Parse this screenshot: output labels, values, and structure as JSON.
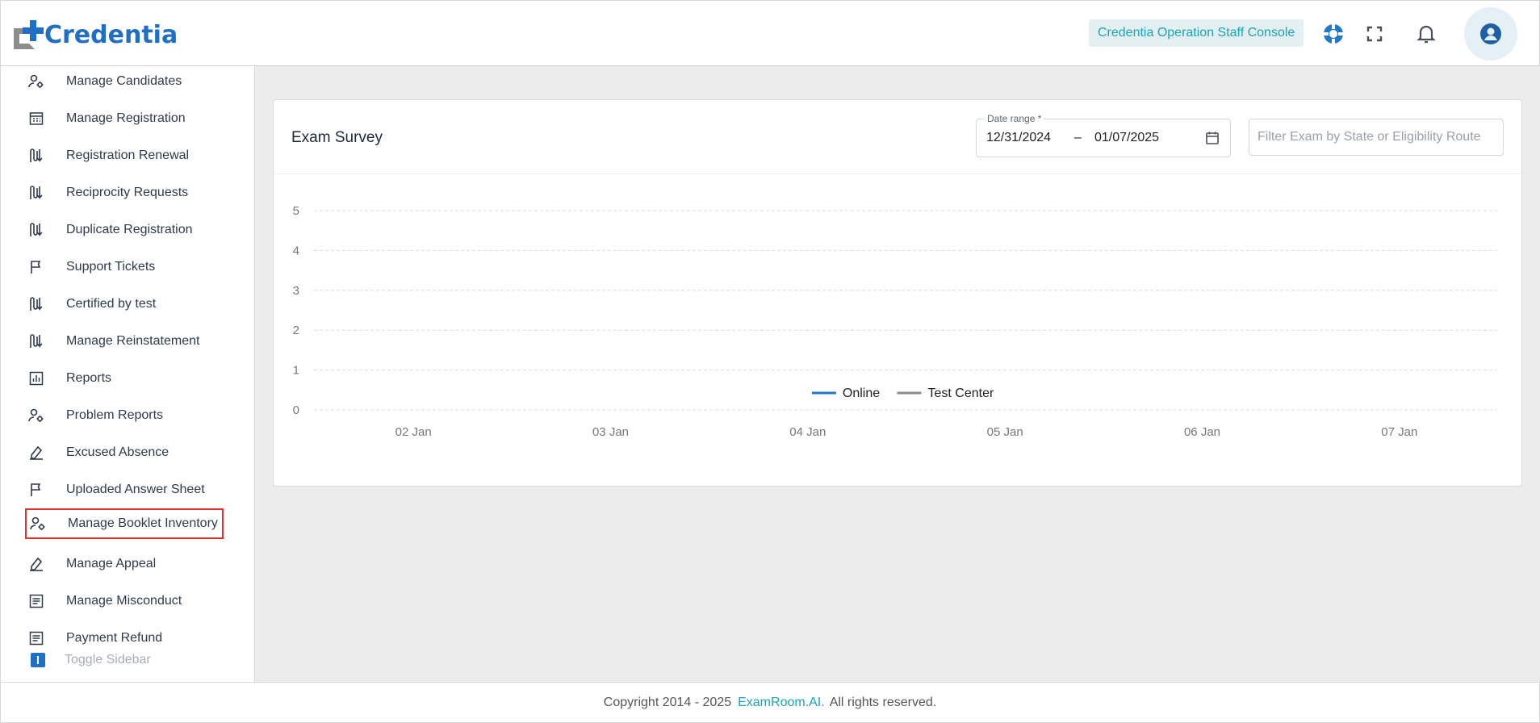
{
  "header": {
    "logo_text": "Credentia",
    "console_label": "Credentia Operation Staff Console",
    "icons": [
      "support-icon",
      "fullscreen-icon",
      "bell-icon",
      "account-icon"
    ]
  },
  "sidebar": {
    "items": [
      {
        "label": "Manage Candidates",
        "icon": "user-gear-icon"
      },
      {
        "label": "Manage Registration",
        "icon": "calendar-grid-icon"
      },
      {
        "label": "Registration Renewal",
        "icon": "swap-arrows-icon"
      },
      {
        "label": "Reciprocity Requests",
        "icon": "swap-arrows-icon"
      },
      {
        "label": "Duplicate Registration",
        "icon": "swap-arrows-icon"
      },
      {
        "label": "Support Tickets",
        "icon": "flag-icon"
      },
      {
        "label": "Certified by test",
        "icon": "swap-arrows-icon"
      },
      {
        "label": "Manage Reinstatement",
        "icon": "swap-arrows-icon"
      },
      {
        "label": "Reports",
        "icon": "bar-chart-icon"
      },
      {
        "label": "Problem Reports",
        "icon": "user-gear-icon"
      },
      {
        "label": "Excused Absence",
        "icon": "stamp-icon"
      },
      {
        "label": "Uploaded Answer Sheet",
        "icon": "flag-icon"
      },
      {
        "label": "Manage Booklet Inventory",
        "icon": "user-gear-icon"
      },
      {
        "label": "Manage Appeal",
        "icon": "stamp-icon"
      },
      {
        "label": "Manage Misconduct",
        "icon": "document-lines-icon"
      },
      {
        "label": "Payment Refund",
        "icon": "document-lines-icon"
      }
    ],
    "toggle_label": "Toggle Sidebar"
  },
  "card": {
    "title": "Exam Survey",
    "date_range_label": "Date range *",
    "date_start": "12/31/2024",
    "date_sep": "–",
    "date_end": "01/07/2025",
    "filter_placeholder": "Filter Exam by State or Eligibility Route"
  },
  "chart_data": {
    "type": "line",
    "x": [
      "02 Jan",
      "03 Jan",
      "04 Jan",
      "05 Jan",
      "06 Jan",
      "07 Jan"
    ],
    "yticks": [
      0,
      1,
      2,
      3,
      4,
      5
    ],
    "ylim": [
      0,
      5
    ],
    "grid": true,
    "legend_position": "bottom",
    "series": [
      {
        "name": "Online",
        "values": [],
        "color": "#1f78c8"
      },
      {
        "name": "Test Center",
        "values": [],
        "color": "#8a8a8a"
      }
    ]
  },
  "footer": {
    "copyright": "Copyright 2014 - 2025",
    "brand": "ExamRoom.AI.",
    "rights": "All rights reserved."
  }
}
